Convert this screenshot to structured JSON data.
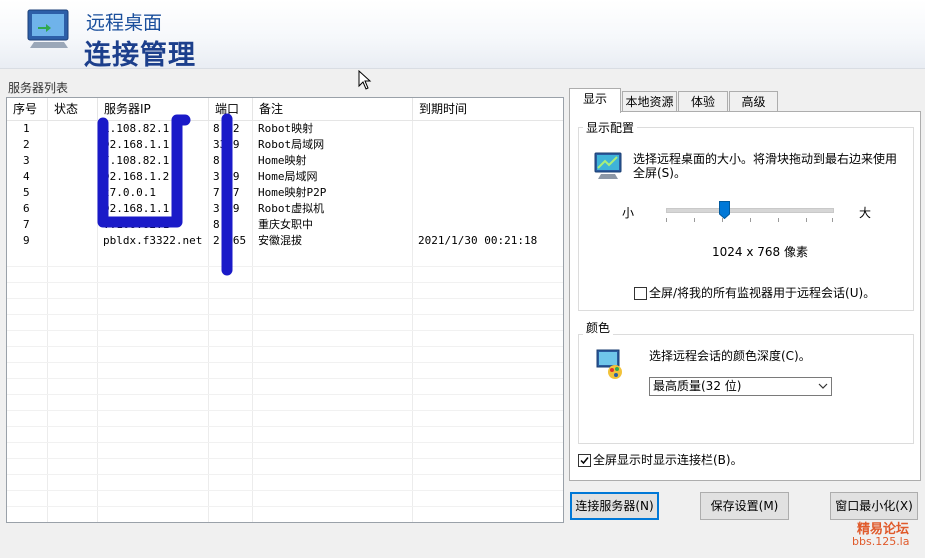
{
  "header": {
    "title_small": "远程桌面",
    "title_big": "连接管理"
  },
  "server_list": {
    "caption": "服务器列表",
    "columns": [
      "序号",
      "状态",
      "服务器IP",
      "端口",
      "备注",
      "到期时间"
    ],
    "rows": [
      {
        "no": "1",
        "status": "",
        "ip": "1.108.82.1",
        "port": "8..2",
        "note": "Robot映射",
        "expiry": ""
      },
      {
        "no": "2",
        "status": "",
        "ip": "92.168.1.1",
        "port": "3389",
        "note": "Robot局域网",
        "expiry": ""
      },
      {
        "no": "3",
        "status": "",
        "ip": "7.108.82.1",
        "port": "8..",
        "note": "Home映射",
        "expiry": ""
      },
      {
        "no": "4",
        "status": "",
        "ip": "92.168.1.2",
        "port": "3..9",
        "note": "Home局域网",
        "expiry": ""
      },
      {
        "no": "5",
        "status": "",
        "ip": "27.0.0.1",
        "port": "7..7",
        "note": "Home映射P2P",
        "expiry": ""
      },
      {
        "no": "6",
        "status": "",
        "ip": "92.168.1.1",
        "port": "3..9",
        "note": "Robot虚拟机",
        "expiry": ""
      },
      {
        "no": "7",
        "status": "",
        "ip": "..108.82.1",
        "port": "8.",
        "note": "重庆女职中",
        "expiry": ""
      },
      {
        "no": "9",
        "status": "",
        "ip": "pbldx.f3322.net",
        "port": "2..65",
        "note": "安徽混拔",
        "expiry": "2021/1/30 00:21:18"
      }
    ]
  },
  "tabs": [
    "显示",
    "本地资源",
    "体验",
    "高级"
  ],
  "display": {
    "group_title": "显示配置",
    "description": "选择远程桌面的大小。将滑块拖动到最右边来使用全屏(S)。",
    "slider_min_label": "小",
    "slider_max_label": "大",
    "slider_value_fraction": 0.35,
    "resolution": "1024 x 768 像素",
    "all_monitors_label": "全屏/将我的所有监视器用于远程会话(U)。",
    "all_monitors_checked": false
  },
  "color": {
    "group_title": "颜色",
    "description": "选择远程会话的颜色深度(C)。",
    "selected": "最高质量(32 位)"
  },
  "fullscreen_bar": {
    "label": "全屏显示时显示连接栏(B)。",
    "checked": true
  },
  "buttons": {
    "connect": "连接服务器(N)",
    "save": "保存设置(M)",
    "minimize": "窗口最小化(X)"
  },
  "watermark": {
    "line1": "精易论坛",
    "line2": "bbs.125.la"
  },
  "colors": {
    "title_blue": "#1c3f8c",
    "marker": "#1a1ac8",
    "accent": "#0078d7"
  }
}
